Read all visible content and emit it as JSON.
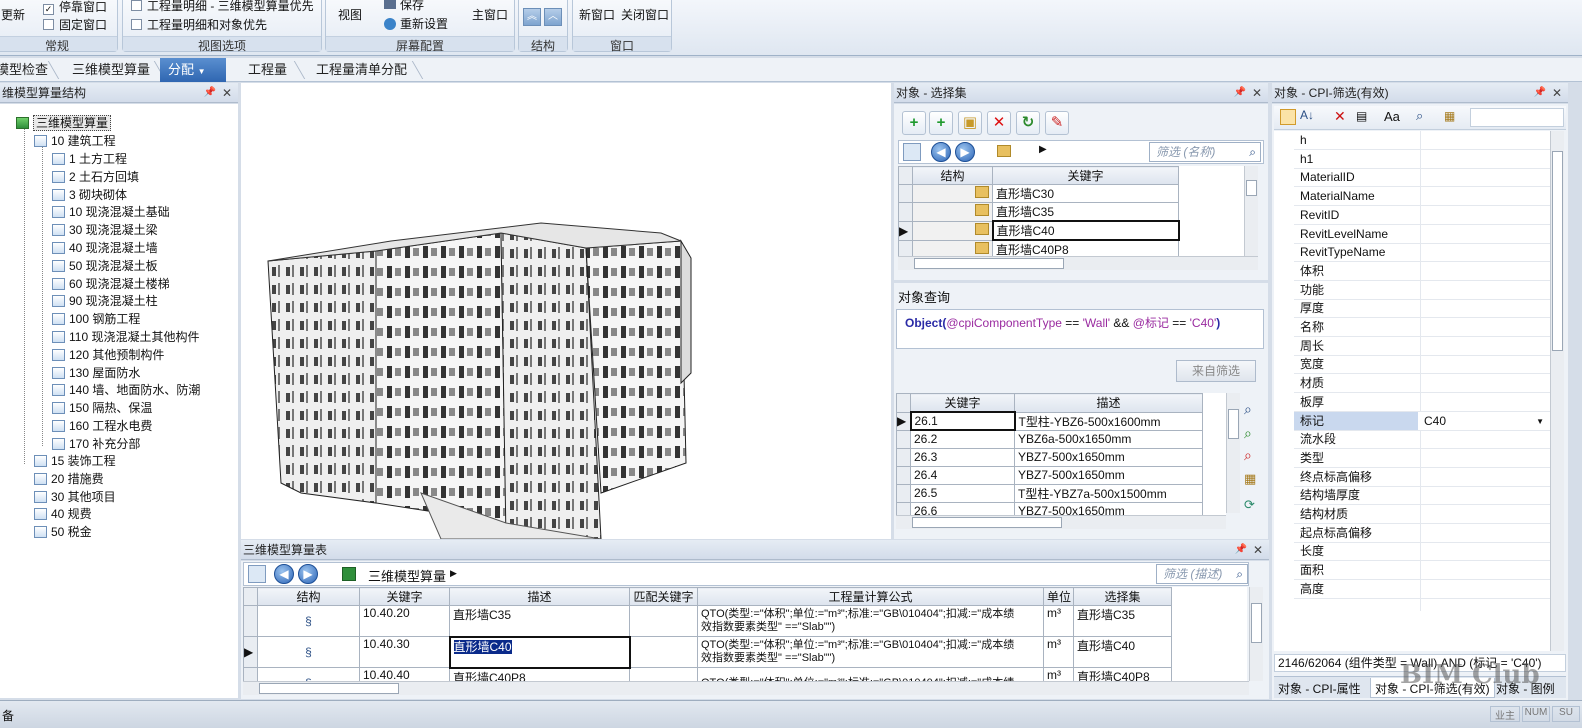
{
  "ribbon": {
    "changgui_update": "更新",
    "dock_window": "停靠窗口",
    "fix_window": "固定窗口",
    "group_changgui": "常规",
    "opt1": "工程量明细 - 三维模型算量优先",
    "opt2": "工程量明细和对象优先",
    "group_view_options": "视图选项",
    "view_btn": "视图",
    "save_btn": "保存",
    "reset_btn": "重新设置",
    "main_window_btn": "主窗口",
    "group_screen": "屏幕配置",
    "group_structure": "结构",
    "new_window_btn": "新窗口",
    "close_window_btn": "关闭窗口",
    "group_window": "窗口"
  },
  "breadcrumb": {
    "items": [
      "模型检查",
      "三维模型算量",
      "分配",
      "工程量",
      "工程量清单分配"
    ],
    "active_index": 2
  },
  "tree_panel": {
    "title": "维模型算量结构",
    "root": "三维模型算量",
    "level1": "10 建筑工程",
    "children": [
      "1 土方工程",
      "2 土石方回填",
      "3 砌块砌体",
      "10 现浇混凝土基础",
      "30 现浇混凝土梁",
      "40 现浇混凝土墙",
      "50 现浇混凝土板",
      "60 现浇混凝土楼梯",
      "90 现浇混凝土柱",
      "100 钢筋工程",
      "110 现浇混凝土其他构件",
      "120 其他预制构件",
      "130 屋面防水",
      "140 墙、地面防水、防潮",
      "150 隔热、保温",
      "160 工程水电费",
      "170 补充分部"
    ],
    "others": [
      "15 装饰工程",
      "20 措施费",
      "30 其他项目",
      "40 规费",
      "50 税金"
    ]
  },
  "selection_panel": {
    "title": "对象 - 选择集",
    "filter_placeholder": "筛选 (名称)",
    "col_structure": "结构",
    "col_keyword": "关键字",
    "rows": [
      "直形墙C30",
      "直形墙C35",
      "直形墙C40",
      "直形墙C40P8"
    ],
    "selected_row": 2
  },
  "query_panel": {
    "title": "对象查询",
    "q_fn": "Object(",
    "q_p1": "@cpiComponentType",
    "q_op1": " == ",
    "q_v1": "'Wall'",
    "q_and": " && ",
    "q_p2": "@标记",
    "q_op2": " == ",
    "q_v2": "'C40'",
    "q_end": ")",
    "from_filter_btn": "来自筛选",
    "col_keyword": "关键字",
    "col_desc": "描述",
    "rows": [
      {
        "k": "26.1",
        "d": "T型柱-YBZ6-500x1600mm"
      },
      {
        "k": "26.2",
        "d": "YBZ6a-500x1650mm"
      },
      {
        "k": "26.3",
        "d": "YBZ7-500x1650mm"
      },
      {
        "k": "26.4",
        "d": "YBZ7-500x1650mm"
      },
      {
        "k": "26.5",
        "d": "T型柱-YBZ7a-500x1500mm"
      },
      {
        "k": "26.6",
        "d": "YBZ7-500x1650mm"
      }
    ]
  },
  "qty_table": {
    "title": "三维模型算量表",
    "breadcrumb": "三维模型算量",
    "filter_placeholder": "筛选 (描述)",
    "headers": [
      "结构",
      "关键字",
      "描述",
      "匹配关键字",
      "工程量计算公式",
      "单位",
      "选择集"
    ],
    "rows": [
      {
        "key": "10.40.20",
        "desc": "直形墙C35",
        "f1": "QTO(类型:=\"体积\";单位:=\"m³\";标准:=\"GB\\010404\";扣减:=\"成本绩",
        "f2": "效指数要素类型\" ==\"Slab\"\")",
        "unit": "m³",
        "sel": "直形墙C35"
      },
      {
        "key": "10.40.30",
        "desc": "直形墙C40",
        "f1": "QTO(类型:=\"体积\";单位:=\"m³\";标准:=\"GB\\010404\";扣减:=\"成本绩",
        "f2": "效指数要素类型\" ==\"Slab\"\")",
        "unit": "m³",
        "sel": "直形墙C40"
      },
      {
        "key": "10.40.40",
        "desc": "直形墙C40P8",
        "f1": "QTO(类型:=\"体积\";单位:=\"m³\";标准:=\"GB\\010404\";扣减:=\"成本绩",
        "f2": "",
        "unit": "m³",
        "sel": "直形墙C40P8"
      }
    ]
  },
  "props_panel": {
    "title": "对象 - CPI-筛选(有效)",
    "rows": [
      {
        "n": "h",
        "v": ""
      },
      {
        "n": "h1",
        "v": ""
      },
      {
        "n": "MaterialID",
        "v": ""
      },
      {
        "n": "MaterialName",
        "v": ""
      },
      {
        "n": "RevitID",
        "v": ""
      },
      {
        "n": "RevitLevelName",
        "v": ""
      },
      {
        "n": "RevitTypeName",
        "v": ""
      },
      {
        "n": "体积",
        "v": ""
      },
      {
        "n": "功能",
        "v": ""
      },
      {
        "n": "厚度",
        "v": ""
      },
      {
        "n": "名称",
        "v": ""
      },
      {
        "n": "周长",
        "v": ""
      },
      {
        "n": "宽度",
        "v": ""
      },
      {
        "n": "材质",
        "v": ""
      },
      {
        "n": "板厚",
        "v": ""
      },
      {
        "n": "标记",
        "v": "C40"
      },
      {
        "n": "流水段",
        "v": ""
      },
      {
        "n": "类型",
        "v": ""
      },
      {
        "n": "终点标高偏移",
        "v": ""
      },
      {
        "n": "结构墙厚度",
        "v": ""
      },
      {
        "n": "结构材质",
        "v": ""
      },
      {
        "n": "起点标高偏移",
        "v": ""
      },
      {
        "n": "长度",
        "v": ""
      },
      {
        "n": "面积",
        "v": ""
      },
      {
        "n": "高度",
        "v": ""
      }
    ],
    "selected_row": 15,
    "summary": "2146/62064  (组件类型 = Wall) AND (标记 = 'C40')",
    "tab1": "对象 - CPI-属性",
    "tab2": "对象 - CPI-筛选(有效)",
    "tab3": "对象 - 图例",
    "toolbar_aa": "Aa"
  },
  "status": {
    "left": "备",
    "ind1": "业主",
    "ind2": "NUM",
    "ind3": "SU"
  },
  "watermark": "BIM Club"
}
